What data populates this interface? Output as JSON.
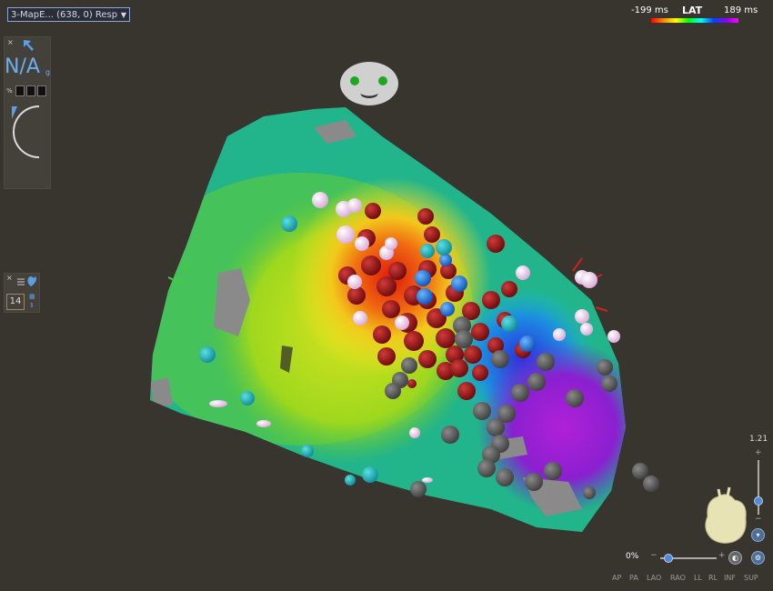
{
  "map_selector": {
    "value": "3-MapE... (638, 0) Resp"
  },
  "lat_legend": {
    "min_label": "-199 ms",
    "title": "LAT",
    "max_label": "189 ms"
  },
  "left_panel": {
    "close": "×",
    "unit_display": "N/A",
    "unit_sub": "g",
    "percent_symbol": "%"
  },
  "tag_panel": {
    "close": "×",
    "count": "14"
  },
  "zoom": {
    "scale_value": "1.21",
    "plus": "+",
    "minus": "−"
  },
  "opacity": {
    "value": "0%",
    "minus": "−",
    "plus": "+"
  },
  "view_buttons": [
    "AP",
    "PA",
    "LAO",
    "RAO",
    "LL",
    "RL",
    "INF",
    "SUP"
  ],
  "colors": {
    "accent": "#8ea6d6",
    "panel_bg": "#44413b",
    "background": "#38352f"
  }
}
